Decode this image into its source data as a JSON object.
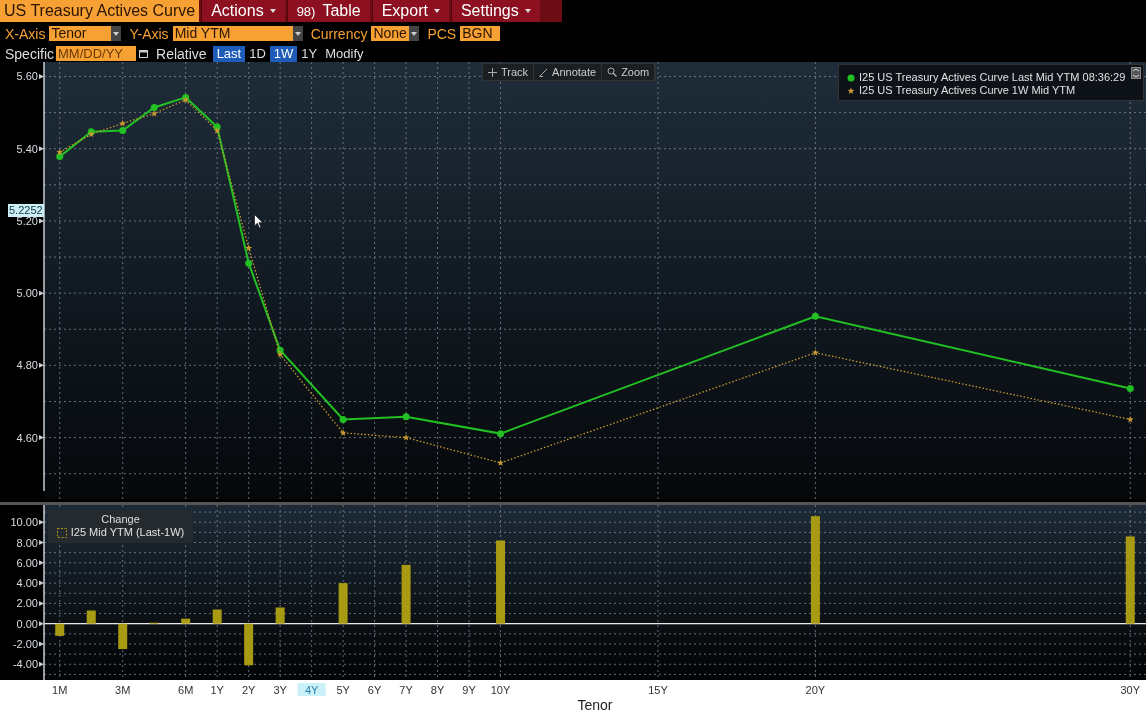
{
  "title_tab": {
    "label": "US Treasury Actives Curve"
  },
  "menu": [
    {
      "label": "Actions",
      "has_menu": true
    },
    {
      "number": "98)",
      "label": "Table",
      "has_menu": false
    },
    {
      "label": "Export",
      "has_menu": true
    },
    {
      "label": "Settings",
      "has_menu": true
    }
  ],
  "controls": [
    {
      "label": "X-Axis",
      "value": "Tenor",
      "dropdown": true
    },
    {
      "label": "Y-Axis",
      "value": "Mid YTM",
      "dropdown": true
    },
    {
      "label": "Currency",
      "value": "None",
      "dropdown": true
    },
    {
      "label": "PCS",
      "value": "BGN",
      "dropdown": false
    }
  ],
  "specific": {
    "label": "Specific",
    "placeholder": "MM/DD/YY"
  },
  "relative": {
    "label": "Relative",
    "options": [
      {
        "label": "Last",
        "selected": true
      },
      {
        "label": "1D",
        "selected": false
      },
      {
        "label": "1W",
        "selected": true
      },
      {
        "label": "1Y",
        "selected": false
      },
      {
        "label": "Modify",
        "selected": false
      }
    ]
  },
  "chart_tools": [
    {
      "label": "Track",
      "kind": "track"
    },
    {
      "label": "Annotate",
      "kind": "annotate"
    },
    {
      "label": "Zoom",
      "kind": "zoom"
    }
  ],
  "main_chart": {
    "crosshair_label": "5.2252",
    "chart_data": {
      "type": "line",
      "grid": true,
      "categories": [
        null,
        null,
        null,
        null,
        null,
        null,
        null,
        null,
        null,
        null,
        null,
        null,
        null,
        null,
        null,
        null,
        null,
        null,
        null,
        null,
        null,
        null,
        null,
        null,
        null,
        null,
        null,
        null,
        null,
        null,
        null,
        null,
        null,
        null,
        null
      ],
      "ylim": [
        4.43,
        5.64
      ],
      "yticks": [
        {
          "value": 4.6,
          "label": "4.60"
        },
        {
          "value": 4.8,
          "label": "4.80"
        },
        {
          "value": 5.0,
          "label": "5.00"
        },
        {
          "value": 5.2,
          "label": "5.20"
        },
        {
          "value": 5.4,
          "label": "5.40"
        },
        {
          "value": 5.6,
          "label": "5.60"
        }
      ],
      "series": [
        {
          "name": "I25 US Treasury Actives Curve Last Mid YTM 08:36:29",
          "color": "#22c022",
          "marker": "circle",
          "line_style": "solid",
          "values": [
            5.378,
            5.447,
            5.45,
            5.514,
            5.542,
            5.46,
            5.083,
            4.842,
            null,
            4.65,
            null,
            4.658,
            null,
            null,
            4.611,
            null,
            null,
            null,
            null,
            null,
            null,
            null,
            null,
            null,
            4.936,
            null,
            null,
            null,
            null,
            null,
            null,
            null,
            null,
            null,
            4.736
          ]
        },
        {
          "name": "I25 US Treasury Actives Curve 1W Mid YTM",
          "color": "#c89a30",
          "marker": "star",
          "line_style": "dotted",
          "values": [
            5.39,
            5.44,
            5.47,
            5.497,
            5.535,
            5.45,
            5.125,
            4.83,
            null,
            4.613,
            null,
            4.6,
            null,
            null,
            4.53,
            null,
            null,
            null,
            null,
            null,
            null,
            null,
            null,
            null,
            4.835,
            null,
            null,
            null,
            null,
            null,
            null,
            null,
            null,
            null,
            4.65
          ]
        }
      ]
    }
  },
  "change_chart": {
    "legend_title": "Change",
    "axis_hover": true,
    "chart_data": {
      "type": "bar",
      "grid": true,
      "xlabel": "Tenor",
      "ylim": [
        -5.55,
        11.7
      ],
      "categories": [
        "1M",
        null,
        "3M",
        null,
        "6M",
        "1Y",
        "2Y",
        "3Y",
        "4Y",
        "5Y",
        "6Y",
        "7Y",
        "8Y",
        "9Y",
        "10Y",
        null,
        null,
        null,
        null,
        "15Y",
        null,
        null,
        null,
        null,
        "20Y",
        null,
        null,
        null,
        null,
        null,
        null,
        null,
        null,
        null,
        "30Y"
      ],
      "yticks": [
        {
          "value": -4,
          "label": "-4.00"
        },
        {
          "value": -2,
          "label": "-2.00"
        },
        {
          "value": 0,
          "label": "0.00"
        },
        {
          "value": 2,
          "label": "2.00"
        },
        {
          "value": 4,
          "label": "4.00"
        },
        {
          "value": 6,
          "label": "6.00"
        },
        {
          "value": 8,
          "label": "8.00"
        },
        {
          "value": 10,
          "label": "10.00"
        }
      ],
      "series": [
        {
          "name": "I25 Mid YTM (Last-1W)",
          "color": "#a89a12",
          "values": [
            -1.2,
            1.3,
            -2.5,
            0.1,
            0.5,
            1.4,
            -4.1,
            1.6,
            null,
            4.0,
            null,
            5.8,
            null,
            null,
            8.2,
            null,
            null,
            null,
            null,
            null,
            null,
            null,
            null,
            null,
            10.6,
            null,
            null,
            null,
            null,
            null,
            null,
            null,
            null,
            null,
            8.6
          ]
        }
      ]
    }
  }
}
